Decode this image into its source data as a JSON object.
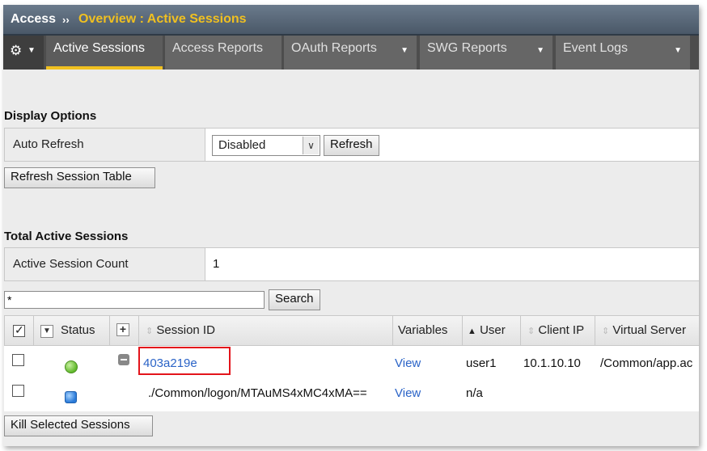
{
  "header": {
    "app": "Access",
    "separator": "››",
    "breadcrumb": "Overview : Active Sessions"
  },
  "nav": {
    "tabs": [
      {
        "label": "Active Sessions",
        "active": true
      },
      {
        "label": "Access Reports"
      },
      {
        "label": "OAuth Reports"
      },
      {
        "label": "SWG Reports"
      },
      {
        "label": "Event Logs"
      }
    ]
  },
  "display_options": {
    "title": "Display Options",
    "auto_refresh_label": "Auto Refresh",
    "auto_refresh_value": "Disabled",
    "refresh_button": "Refresh",
    "refresh_table_button": "Refresh Session Table"
  },
  "totals": {
    "title": "Total Active Sessions",
    "count_label": "Active Session Count",
    "count_value": "1"
  },
  "search": {
    "value": "*",
    "button": "Search"
  },
  "table": {
    "columns": {
      "status": "Status",
      "session_id": "Session ID",
      "variables": "Variables",
      "user": "User",
      "client_ip": "Client IP",
      "virtual_server": "Virtual Server"
    },
    "rows": [
      {
        "session_id": "403a219e",
        "variables": "View",
        "user": "user1",
        "client_ip": "10.1.10.10",
        "virtual_server": "/Common/app.ac"
      },
      {
        "session_id": "./Common/logon/MTAuMS4xMC4xMA==",
        "variables": "View",
        "user": "n/a",
        "client_ip": "",
        "virtual_server": ""
      }
    ]
  },
  "kill_button": "Kill Selected Sessions",
  "colors": {
    "accent": "#f0c020",
    "link": "#2a63c7",
    "highlight": "#e3141b"
  }
}
